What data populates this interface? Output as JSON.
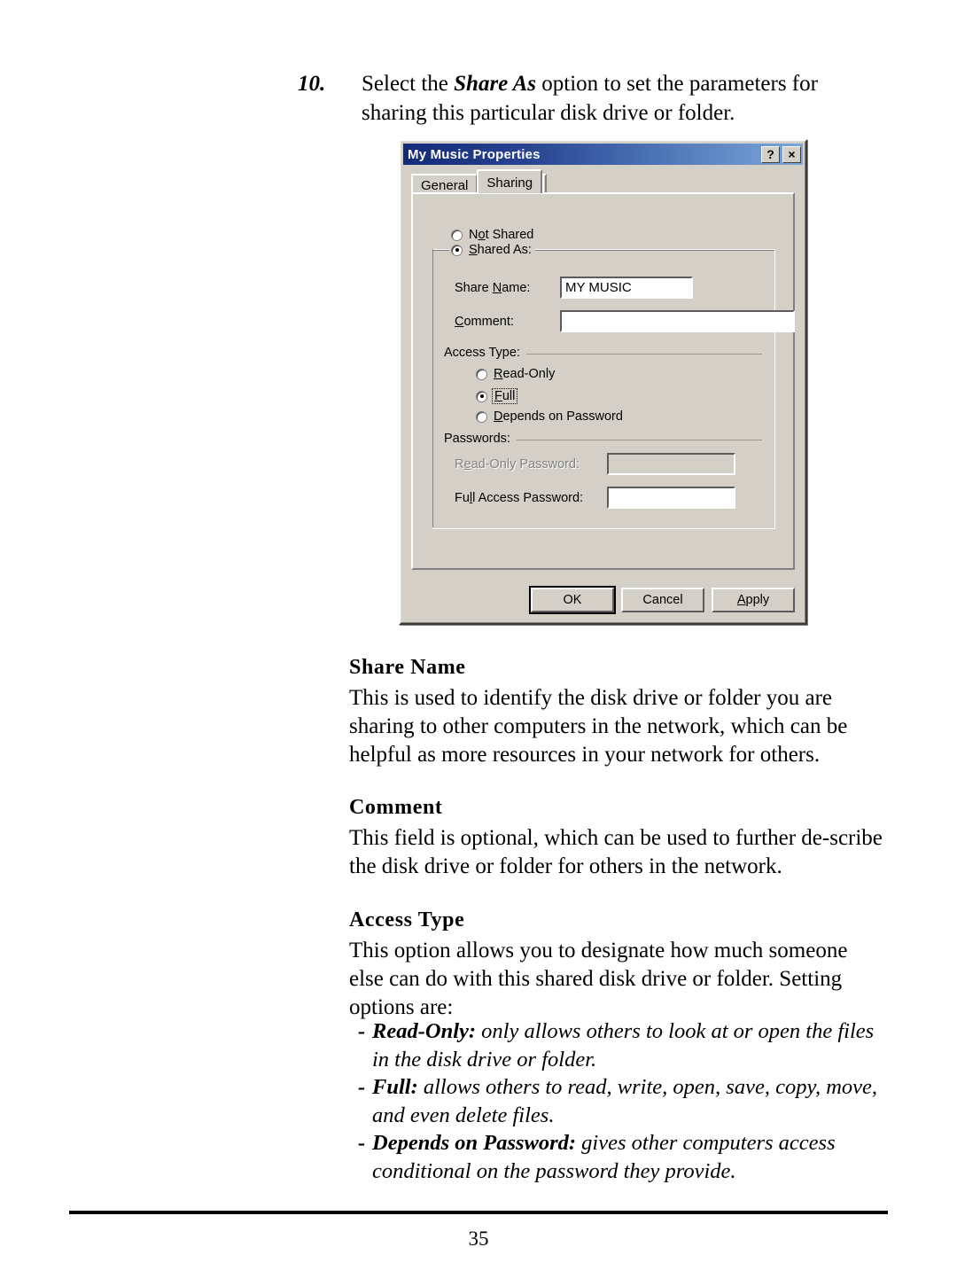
{
  "step": {
    "number": "10.",
    "text_before": "Select the ",
    "emphasis": "Share As",
    "text_after": " option to set the parameters for sharing this particular disk drive or folder."
  },
  "dialog": {
    "title": "My Music Properties",
    "help_button": "?",
    "close_button": "×",
    "tabs": [
      {
        "label": "General",
        "active": false
      },
      {
        "label": "Sharing",
        "active": true
      }
    ],
    "not_shared_label": "Not Shared",
    "shared_as_label": "Shared As:",
    "share_name_label": "Share Name:",
    "share_name_value": "MY MUSIC",
    "comment_label": "Comment:",
    "comment_value": "",
    "access_type_legend": "Access Type:",
    "access_options": [
      {
        "label": "Read-Only",
        "selected": false
      },
      {
        "label": "Full",
        "selected": true
      },
      {
        "label": "Depends on Password",
        "selected": false
      }
    ],
    "passwords_legend": "Passwords:",
    "read_only_password_label": "Read-Only Password:",
    "read_only_password_value": "",
    "full_access_password_label": "Full Access Password:",
    "full_access_password_value": "",
    "buttons": {
      "ok": "OK",
      "cancel": "Cancel",
      "apply": "Apply"
    },
    "colors": {
      "face": "#d4d0c8",
      "title_gradient_start": "#132a78",
      "title_gradient_end": "#7ba7da",
      "title_text": "#ffffff",
      "disabled_text": "#808080"
    }
  },
  "sections": [
    {
      "heading": "Share Name",
      "body": "This is used to identify the disk drive or folder you are sharing to other computers in the network, which can be helpful as more resources in your network for others."
    },
    {
      "heading": "Comment",
      "body": "This field is optional, which can be used to further de-scribe the disk drive or folder for others in the network."
    },
    {
      "heading": "Access Type",
      "body": "This option allows you to designate how much someone else can do with this shared disk drive or folder.  Setting options are:"
    }
  ],
  "bullets": [
    {
      "dash": "-",
      "term": "Read-Only:",
      "text": " only allows others to look at or open the files in the disk drive or folder."
    },
    {
      "dash": "-",
      "term": "Full:",
      "text": " allows others to read, write, open, save, copy, move, and even delete files."
    },
    {
      "dash": "-",
      "term": "Depends on Password:",
      "text": " gives other computers access conditional on the password they provide."
    }
  ],
  "footer": {
    "page_number": "35"
  }
}
